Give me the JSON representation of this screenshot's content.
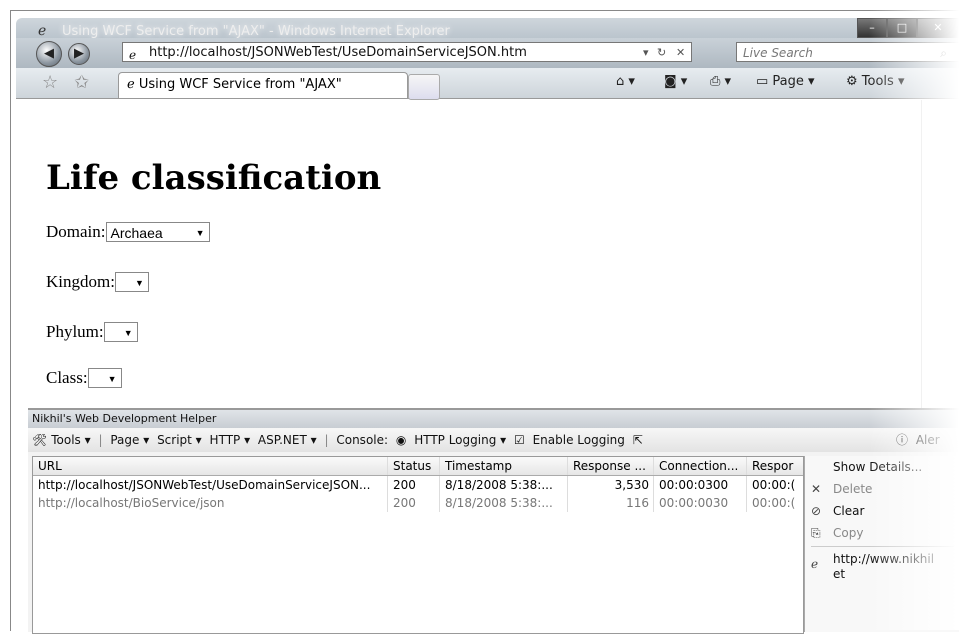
{
  "window": {
    "title": "Using WCF Service from \"AJAX\" - Windows Internet Explorer",
    "minimize": "–",
    "maximize": "□",
    "close": "✕"
  },
  "nav": {
    "back": "◀",
    "forward": "▶",
    "address": "http://localhost/JSONWebTest/UseDomainServiceJSON.htm",
    "refresh": "↻",
    "stop": "✕",
    "search_placeholder": "Live Search"
  },
  "tabs": {
    "active": "Using WCF Service from \"AJAX\""
  },
  "commands": {
    "page": "Page ▾",
    "tools": "Tools ▾"
  },
  "page": {
    "heading": "Life classification",
    "domain_label": "Domain:",
    "domain_value": "Archaea",
    "kingdom_label": "Kingdom:",
    "phylum_label": "Phylum:",
    "class_label": "Class:"
  },
  "devhelper": {
    "title": "Nikhil's Web Development Helper",
    "toolbar": {
      "tools": "Tools ▾",
      "page": "Page ▾",
      "script": "Script ▾",
      "http": "HTTP ▾",
      "aspnet": "ASP.NET ▾",
      "console_label": "Console:",
      "http_logging": "HTTP Logging ▾",
      "enable_logging": "Enable Logging",
      "alerts": "Aler"
    },
    "columns": [
      "URL",
      "Status",
      "Timestamp",
      "Response ...",
      "Connection...",
      "Respor"
    ],
    "rows": [
      [
        "http://localhost/JSONWebTest/UseDomainServiceJSON...",
        "200",
        "8/18/2008 5:38:...",
        "3,530",
        "00:00:0300",
        "00:00:("
      ],
      [
        "http://localhost/BioService/json",
        "200",
        "8/18/2008 5:38:...",
        "116",
        "00:00:0030",
        "00:00:("
      ]
    ],
    "menu": {
      "show_details": "Show Details...",
      "delete": "Delete",
      "clear": "Clear",
      "copy": "Copy",
      "link": "http://www.nikhil",
      "link2": "et"
    }
  }
}
